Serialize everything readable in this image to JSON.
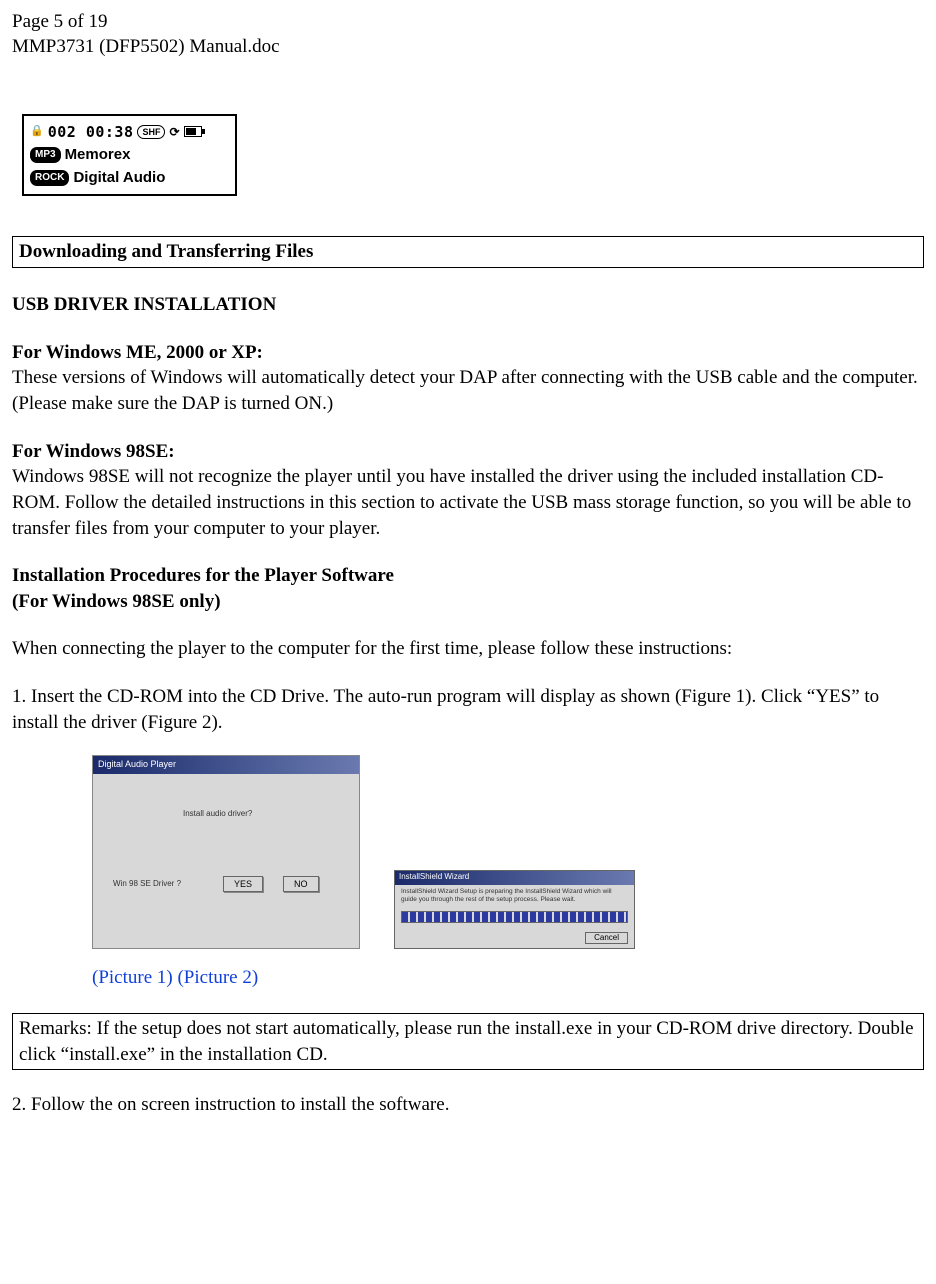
{
  "header": {
    "page_line": "Page 5 of 19",
    "doc_line": "MMP3731 (DFP5502) Manual.doc"
  },
  "lcd": {
    "lock": "🔒",
    "track_time": "002 00:38",
    "shf": "SHF",
    "mode_icon": "⟳",
    "mp3_badge": "MP3",
    "line2": "Memorex",
    "rock_badge": "ROCK",
    "line3": "Digital Audio"
  },
  "section_title": "Downloading and Transferring Files",
  "h_usb": "USB DRIVER INSTALLATION",
  "h_me": "For Windows ME, 2000 or XP:",
  "p_me": "These versions of Windows will automatically detect your DAP after connecting with the USB cable and the computer.  (Please make sure the DAP is turned ON.)",
  "h_98": "For Windows 98SE:",
  "p_98": "Windows 98SE will not recognize the player until you have installed the driver using the included installation CD-ROM.  Follow the detailed instructions in this section to activate the USB mass storage function, so you will be able to transfer files from your computer to your player.",
  "h_proc1": "Installation Procedures for the Player Software",
  "h_proc2": "(For Windows 98SE only)",
  "p_connect": "When connecting the player to the computer for the first time, please follow these instructions:",
  "step1": "1. Insert the CD-ROM into the CD Drive.  The auto-run program will display as shown (Figure 1).  Click “YES” to install the driver (Figure 2).",
  "fig1": {
    "titlebar": "Digital Audio Player",
    "msg": "Install audio driver?",
    "label": "Win 98 SE Driver ?",
    "yes": "YES",
    "no": "NO"
  },
  "fig2": {
    "titlebar": "InstallShield Wizard",
    "body": "InstallShield Wizard Setup is preparing the InstallShield Wizard which will guide you through the rest of the setup process. Please wait.",
    "cancel": "Cancel"
  },
  "captions": "(Picture 1)  (Picture 2)",
  "remarks": "Remarks: If the setup does not start automatically, please run the install.exe in your CD-ROM drive directory.  Double click “install.exe” in the installation CD.",
  "step2": "2. Follow the on screen instruction to install the software."
}
